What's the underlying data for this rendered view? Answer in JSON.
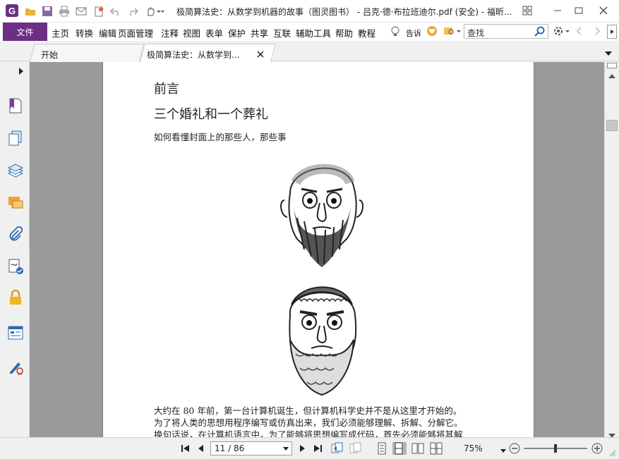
{
  "window": {
    "title": "极简算法史：从数学到机器的故事（图灵图书） - 吕克·德·布拉班迪尔.pdf (安全) - 福昕..."
  },
  "menu": {
    "file": "文件",
    "items": [
      "主页",
      "转换",
      "编辑",
      "页面管理",
      "注释",
      "视图",
      "表单",
      "保护",
      "共享",
      "互联",
      "辅助工具",
      "帮助",
      "教程"
    ],
    "tell_me": "告诉",
    "search_placeholder": "查找"
  },
  "tabs": [
    {
      "label": "开始"
    },
    {
      "label": "极简算法史：从数学到..."
    }
  ],
  "document": {
    "heading_preface": "前言",
    "heading_chapter": "三个婚礼和一个葬礼",
    "subtitle": "如何看懂封面上的那些人，那些事",
    "paragraph_lines": [
      "大约在 80 年前，第一台计算机诞生，但计算机科学史并不是从这里才开始的。",
      "为了将人类的思想用程序编写或仿真出来，我们必须能够理解、拆解、分解它。",
      "换句话说，在计算机语言中，为了能够将思想编写成代码，首先必须能够将其解"
    ]
  },
  "status": {
    "page_indicator": "11 / 86",
    "zoom": "75%",
    "zoom_slider": 0.5
  },
  "colors": {
    "accent": "#6b2f86",
    "doc_background": "#9a9a9a",
    "logo_red": "#c8102e"
  }
}
